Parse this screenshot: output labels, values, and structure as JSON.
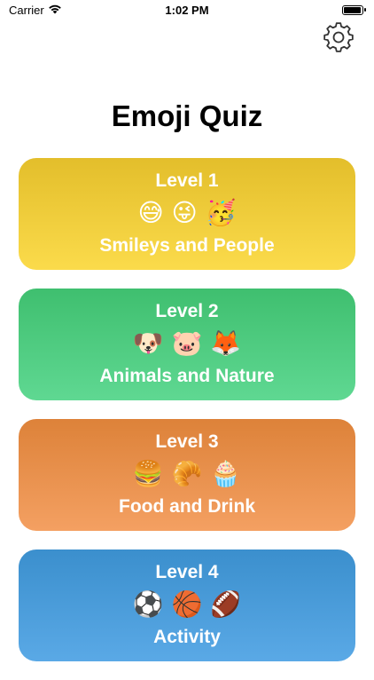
{
  "status_bar": {
    "carrier": "Carrier",
    "time": "1:02 PM",
    "battery_level": 1.0
  },
  "settings": {
    "icon": "gear-icon"
  },
  "title": "Emoji Quiz",
  "levels": [
    {
      "title": "Level 1",
      "emojis": "😅 😜 🥳",
      "subtitle": "Smileys and People",
      "gradient_top": "#e3be2b",
      "gradient_bottom": "#fbdb4b"
    },
    {
      "title": "Level 2",
      "emojis": "🐶 🐷 🦊",
      "subtitle": "Animals and Nature",
      "gradient_top": "#3fbf6f",
      "gradient_bottom": "#5fd892"
    },
    {
      "title": "Level 3",
      "emojis": "🍔 🥐 🧁",
      "subtitle": "Food and Drink",
      "gradient_top": "#dd8239",
      "gradient_bottom": "#f4a062"
    },
    {
      "title": "Level 4",
      "emojis": "⚽ 🏀 🏈",
      "subtitle": "Activity",
      "gradient_top": "#3b8fcd",
      "gradient_bottom": "#5aa9e6"
    }
  ]
}
